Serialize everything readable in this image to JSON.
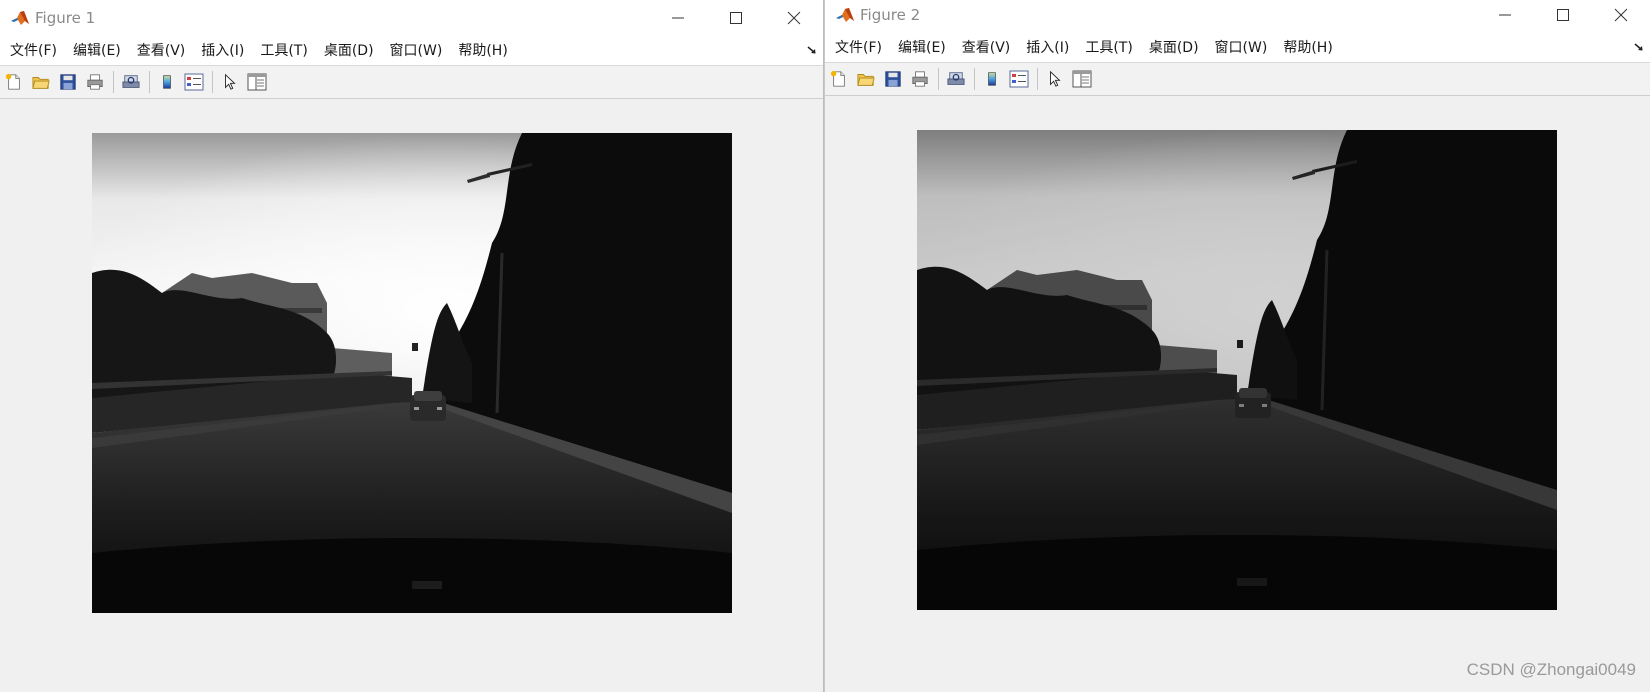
{
  "windows": [
    {
      "title": "Figure 1",
      "menu": [
        "文件(F)",
        "编辑(E)",
        "查看(V)",
        "插入(I)",
        "工具(T)",
        "桌面(D)",
        "窗口(W)",
        "帮助(H)"
      ],
      "toolbar": [
        "new-figure-icon",
        "open-file-icon",
        "save-icon",
        "print-icon",
        "print-preview-icon",
        "colorbar-icon",
        "legend-icon",
        "pointer-icon",
        "property-inspector-icon"
      ],
      "image": "grayscale road scene with car ahead"
    },
    {
      "title": "Figure 2",
      "menu": [
        "文件(F)",
        "编辑(E)",
        "查看(V)",
        "插入(I)",
        "工具(T)",
        "桌面(D)",
        "窗口(W)",
        "帮助(H)"
      ],
      "toolbar": [
        "new-figure-icon",
        "open-file-icon",
        "save-icon",
        "print-icon",
        "print-preview-icon",
        "colorbar-icon",
        "legend-icon",
        "pointer-icon",
        "property-inspector-icon"
      ],
      "image": "grayscale road scene with car ahead, darker"
    }
  ],
  "watermark": "CSDN @Zhongai0049",
  "colors": {
    "titlebar": "#ffffff",
    "window_bg": "#f0f0f0",
    "title_text": "#8a8a8a",
    "matlab_orange": "#d4591c"
  }
}
